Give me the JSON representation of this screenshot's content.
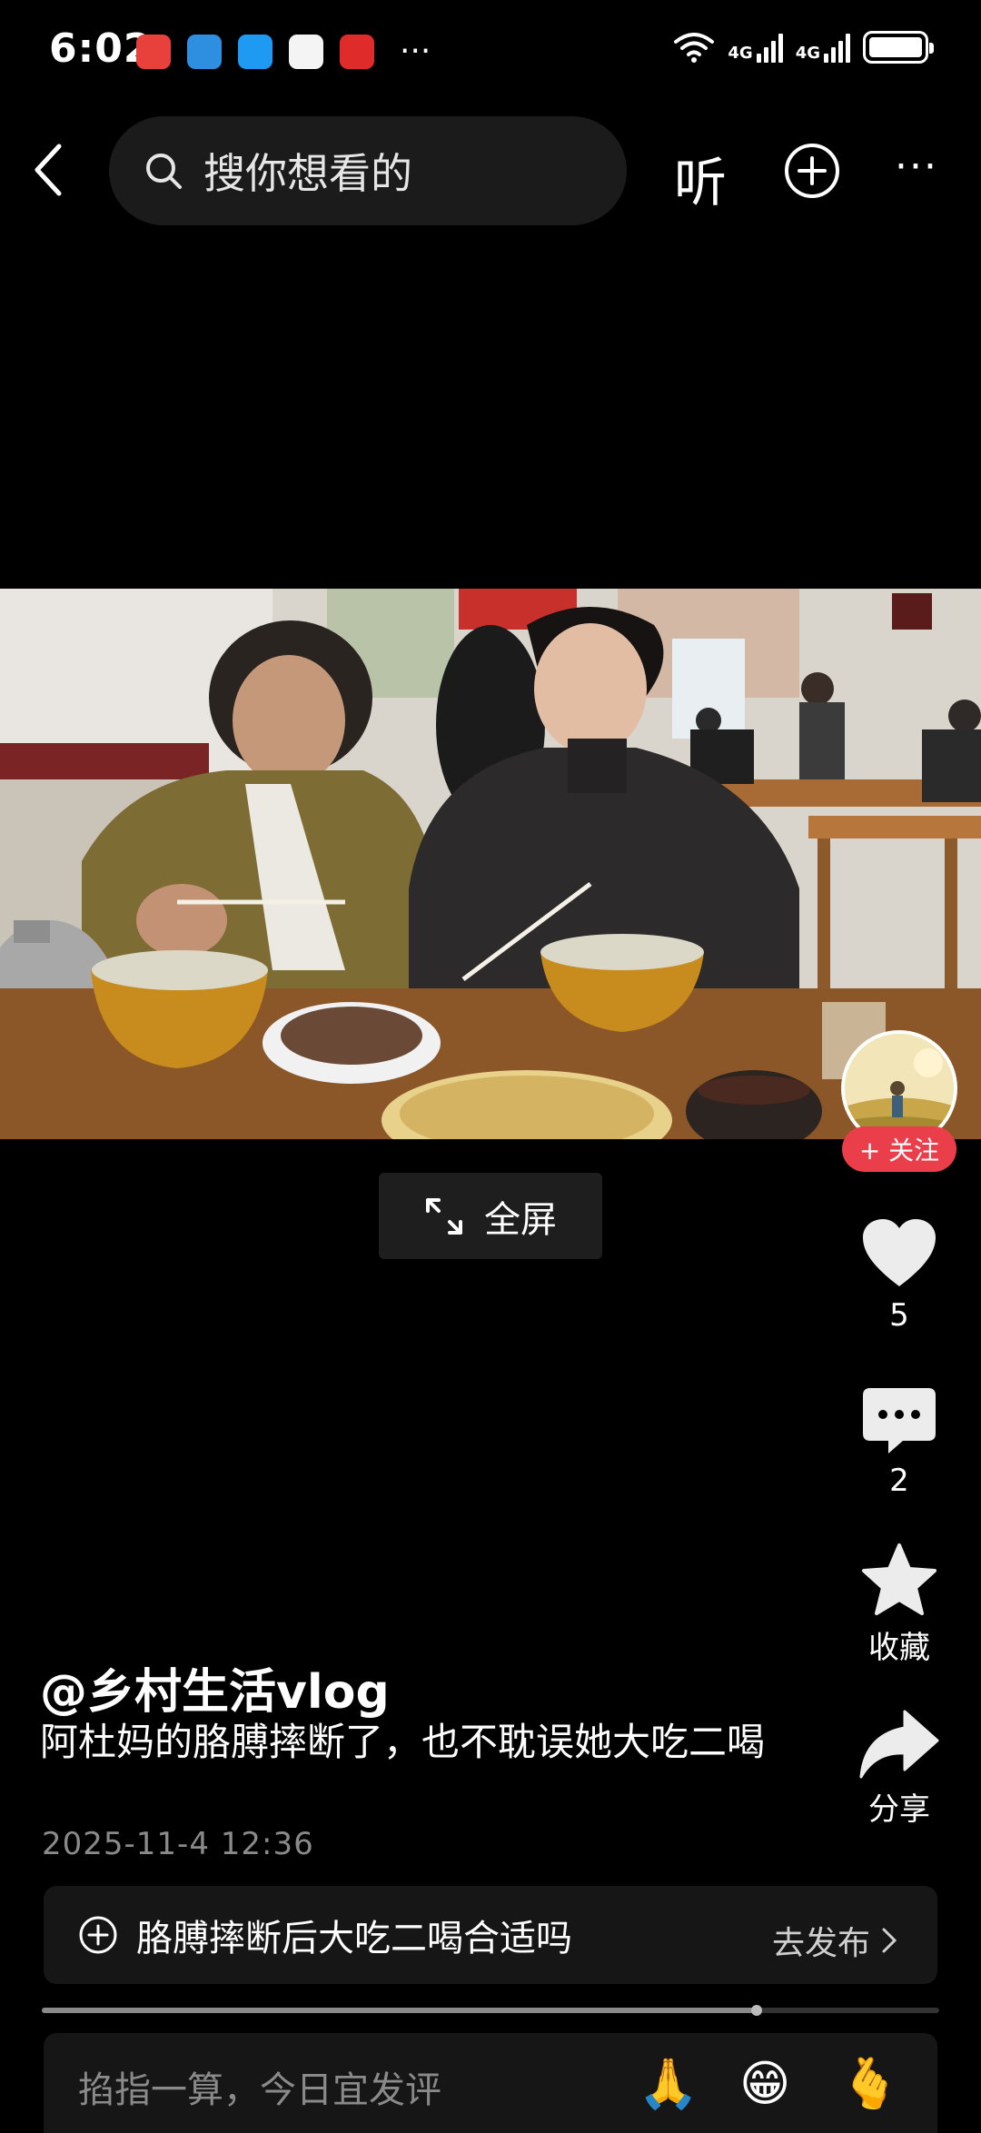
{
  "status_bar": {
    "time": "6:02",
    "network_1": "4G",
    "network_2": "4G"
  },
  "top_nav": {
    "search_placeholder": "搜你想看的",
    "listen_label": "听",
    "more_label": "···"
  },
  "video": {
    "fullscreen_label": "全屏"
  },
  "creator": {
    "follow_label": "+ 关注"
  },
  "actions": {
    "like_count": "5",
    "comment_count": "2",
    "favorite_label": "收藏",
    "share_label": "分享"
  },
  "post": {
    "author": "@乡村生活vlog",
    "description": "阿杜妈的胳膊摔断了，也不耽误她大吃二喝",
    "date": "2025-11-4 12:36"
  },
  "topic": {
    "text": "胳膊摔断后大吃二喝合适吗",
    "publish_label": "去发布"
  },
  "playback": {
    "progress": 0.797
  },
  "comment": {
    "placeholder": "掐指一算，今日宜发评",
    "emojis": [
      "🙏",
      "😁",
      "🫰"
    ]
  },
  "colors": {
    "follow": "#ea3e4b",
    "background": "#000000"
  }
}
